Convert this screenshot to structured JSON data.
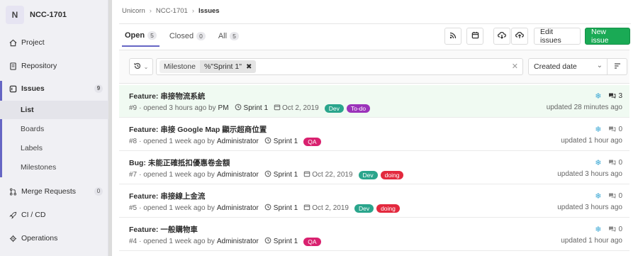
{
  "project": {
    "initial": "N",
    "name": "NCC-1701"
  },
  "sidebar": {
    "items": [
      {
        "label": "Project",
        "icon": "home-icon"
      },
      {
        "label": "Repository",
        "icon": "repository-icon"
      },
      {
        "label": "Issues",
        "icon": "issues-icon",
        "count": "9"
      },
      {
        "label": "Merge Requests",
        "icon": "merge-request-icon",
        "count": "0"
      },
      {
        "label": "CI / CD",
        "icon": "rocket-icon"
      },
      {
        "label": "Operations",
        "icon": "operations-icon"
      }
    ],
    "subitems": [
      "List",
      "Boards",
      "Labels",
      "Milestones"
    ]
  },
  "breadcrumb": [
    "Unicorn",
    "NCC-1701",
    "Issues"
  ],
  "tabs": [
    {
      "label": "Open",
      "count": "5"
    },
    {
      "label": "Closed",
      "count": "0"
    },
    {
      "label": "All",
      "count": "5"
    }
  ],
  "toolbar": {
    "edit_label": "Edit issues",
    "new_label": "New issue"
  },
  "filter": {
    "token_name": "Milestone",
    "token_value": "%\"Sprint 1\"",
    "sort_label": "Created date"
  },
  "colors": {
    "dev": "#2aa58c",
    "todo": "#9b33ba",
    "doing": "#e3293e",
    "qa": "#d9216f",
    "accent": "#6666c4",
    "green": "#1aaa55"
  },
  "issues": [
    {
      "title": "Feature: 串接物流系統",
      "ref": "#9",
      "opened": "· opened 3 hours ago by",
      "author": "PM",
      "milestone": "Sprint 1",
      "due": "Oct 2, 2019",
      "labels": [
        {
          "text": "Dev",
          "color": "#2aa58c"
        },
        {
          "text": "To-do",
          "color": "#9b33ba"
        }
      ],
      "comments": "3",
      "updated": "updated 28 minutes ago"
    },
    {
      "title": "Feature: 串接 Google Map 顯示超商位置",
      "ref": "#8",
      "opened": "· opened 1 week ago by",
      "author": "Administrator",
      "milestone": "Sprint 1",
      "due": "",
      "labels": [
        {
          "text": "QA",
          "color": "#d9216f"
        }
      ],
      "comments": "0",
      "updated": "updated 1 hour ago"
    },
    {
      "title": "Bug: 未能正確抵扣優惠卷金額",
      "ref": "#7",
      "opened": "· opened 1 week ago by",
      "author": "Administrator",
      "milestone": "Sprint 1",
      "due": "Oct 22, 2019",
      "labels": [
        {
          "text": "Dev",
          "color": "#2aa58c"
        },
        {
          "text": "doing",
          "color": "#e3293e"
        }
      ],
      "comments": "0",
      "updated": "updated 3 hours ago"
    },
    {
      "title": "Feature: 串接線上金流",
      "ref": "#5",
      "opened": "· opened 1 week ago by",
      "author": "Administrator",
      "milestone": "Sprint 1",
      "due": "Oct 2, 2019",
      "labels": [
        {
          "text": "Dev",
          "color": "#2aa58c"
        },
        {
          "text": "doing",
          "color": "#e3293e"
        }
      ],
      "comments": "0",
      "updated": "updated 3 hours ago"
    },
    {
      "title": "Feature: 一般購物車",
      "ref": "#4",
      "opened": "· opened 1 week ago by",
      "author": "Administrator",
      "milestone": "Sprint 1",
      "due": "",
      "labels": [
        {
          "text": "QA",
          "color": "#d9216f"
        }
      ],
      "comments": "0",
      "updated": "updated 1 hour ago"
    }
  ]
}
